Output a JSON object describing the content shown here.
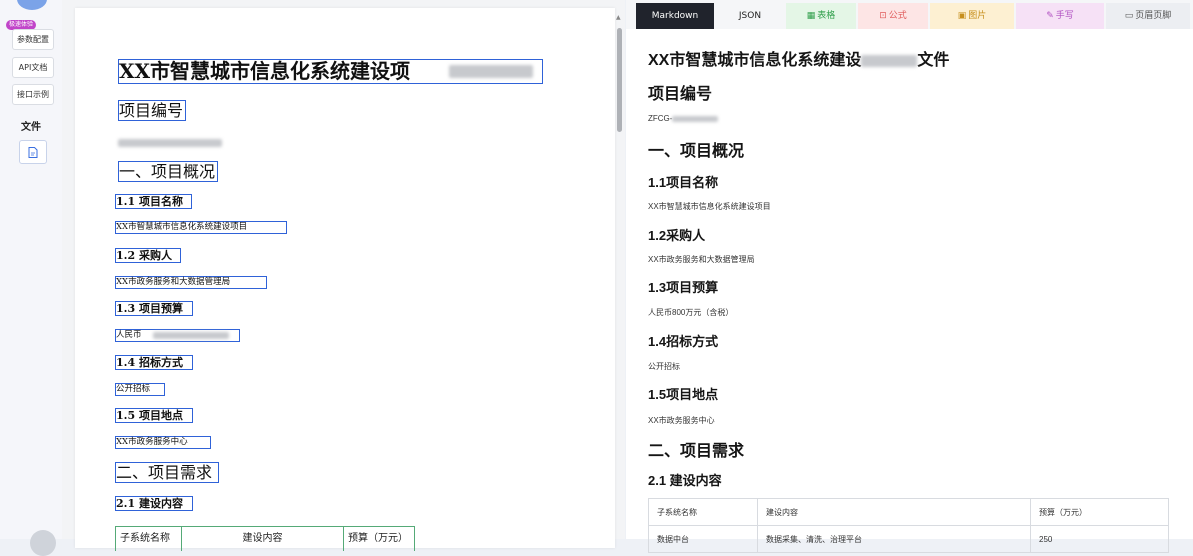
{
  "sidebar": {
    "badge": "极速体验",
    "buttons": [
      "参数配置",
      "API文档",
      "接口示例"
    ],
    "section_title": "文件"
  },
  "document": {
    "title": "XX市智慧城市信息化系统建设项",
    "sections": {
      "project_number_heading": "项目编号",
      "overview_heading": "一、项目概况",
      "name_heading": "1.1 项目名称",
      "name_value": "XX市智慧城市信息化系统建设项目",
      "purchaser_heading": "1.2 采购人",
      "purchaser_value": "XX市政务服务和大数据管理局",
      "budget_heading": "1.3 项目预算",
      "budget_value": "人民币",
      "method_heading": "1.4 招标方式",
      "method_value": "公开招标",
      "location_heading": "1.5 项目地点",
      "location_value": "XX市政务服务中心",
      "requirements_heading": "二、项目需求",
      "content_heading": "2.1 建设内容"
    },
    "table_headers": [
      "子系统名称",
      "建设内容",
      "预算（万元）"
    ]
  },
  "output_tabs": [
    {
      "label": "Markdown",
      "icon": ""
    },
    {
      "label": "JSON",
      "icon": ""
    },
    {
      "label": "表格",
      "icon": "▦"
    },
    {
      "label": "公式",
      "icon": "⊡"
    },
    {
      "label": "图片",
      "icon": "▣"
    },
    {
      "label": "手写",
      "icon": "✎"
    },
    {
      "label": "页眉页脚",
      "icon": "▭"
    }
  ],
  "tab_colors": [
    "#20232c",
    "#f5f6f8",
    "#e4f6e6",
    "#fde5e5",
    "#fdf0d2",
    "#f6e1f6",
    "#eceef2"
  ],
  "tab_text_colors": [
    "#ffffff",
    "#222222",
    "#2f9e4a",
    "#e05b5b",
    "#c78f1d",
    "#b04fc1",
    "#555555"
  ],
  "output": {
    "title": "XX市智慧城市信息化系统建设",
    "title_tail": "文件",
    "project_number_heading": "项目编号",
    "project_number_prefix": "ZFCG-",
    "overview_heading": "一、项目概况",
    "name_heading": "1.1项目名称",
    "name_value": "XX市智慧城市信息化系统建设项目",
    "purchaser_heading": "1.2采购人",
    "purchaser_value": "XX市政务服务和大数据管理局",
    "budget_heading": "1.3项目预算",
    "budget_value": "人民币800万元（含税）",
    "method_heading": "1.4招标方式",
    "method_value": "公开招标",
    "location_heading": "1.5项目地点",
    "location_value": "XX市政务服务中心",
    "requirements_heading": "二、项目需求",
    "content_heading": "2.1 建设内容",
    "table": {
      "headers": [
        "子系统名称",
        "建设内容",
        "预算（万元）"
      ],
      "first_row": [
        "数据中台",
        "数据采集、清洗、治理平台",
        "250"
      ]
    }
  }
}
